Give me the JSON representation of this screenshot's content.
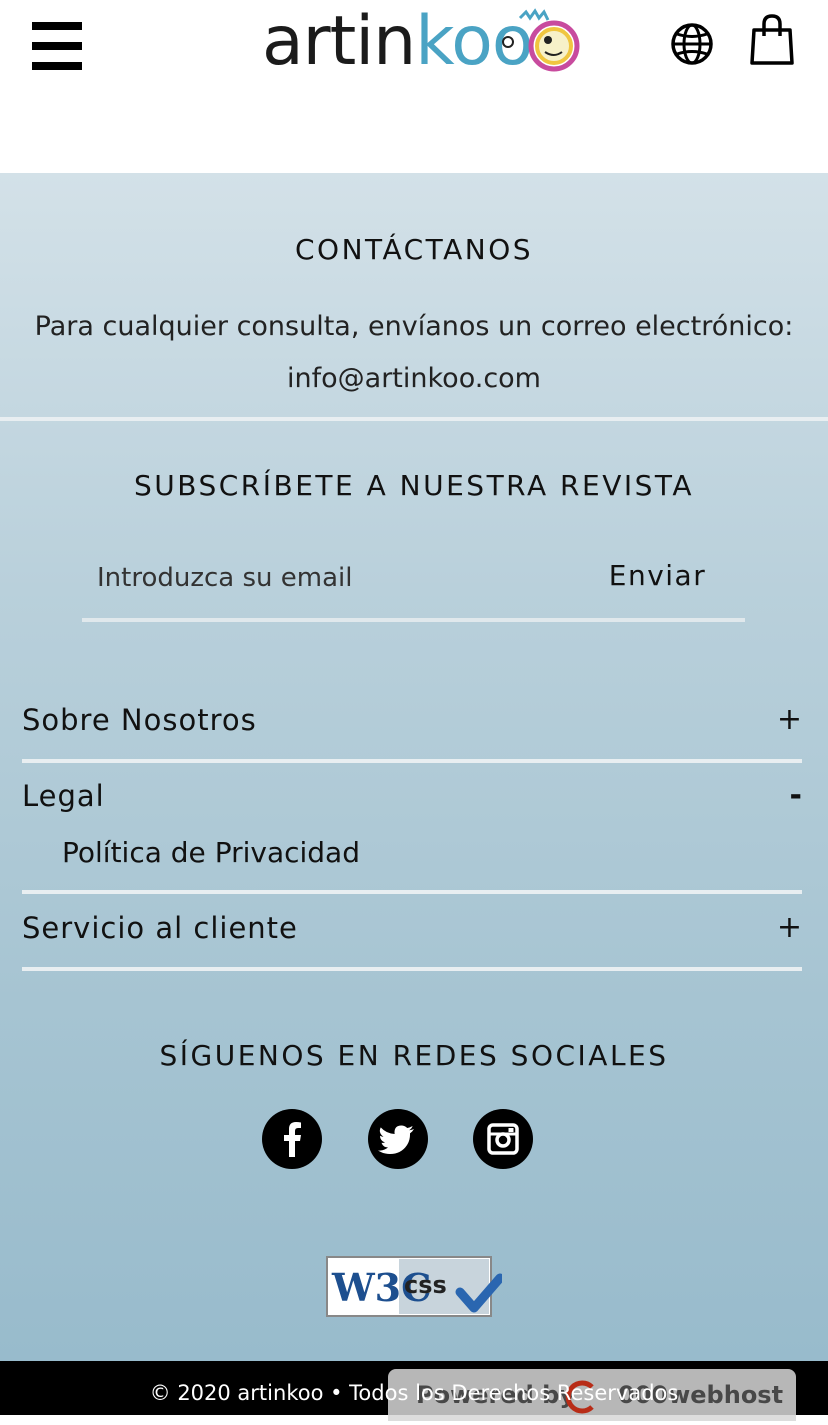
{
  "header": {
    "logo_text_dark": "artin",
    "logo_text_accent": "koo",
    "menu_icon": "hamburger-icon",
    "language_icon": "globe-icon",
    "cart_icon": "shopping-bag-icon"
  },
  "contact": {
    "title": "CONTÁCTANOS",
    "text": "Para cualquier consulta, envíanos un correo electrónico:",
    "email": "info@artinkoo.com"
  },
  "subscribe": {
    "title": "SUBSCRÍBETE A NUESTRA REVISTA",
    "placeholder": "Introduzca su email",
    "button_label": "Enviar"
  },
  "accordion": [
    {
      "label": "Sobre Nosotros",
      "toggle": "+"
    },
    {
      "label": "Legal",
      "toggle": "-",
      "items": [
        "Política de Privacidad"
      ]
    },
    {
      "label": "Servicio al cliente",
      "toggle": "+"
    }
  ],
  "social": {
    "title": "SÍGUENOS EN REDES SOCIALES",
    "icons": [
      "facebook-icon",
      "twitter-icon",
      "instagram-icon"
    ]
  },
  "badge": {
    "w3c": "W3C",
    "css": "css"
  },
  "footer": {
    "copyright": "© 2020 artinkoo • Todos los Derechos Reservados",
    "powered_by": "Powered by",
    "powered_brand": "000webhost"
  },
  "colors": {
    "accent": "#4aa3c4",
    "footer_top": "#d3e1e8",
    "footer_bottom": "#98bbcc"
  }
}
